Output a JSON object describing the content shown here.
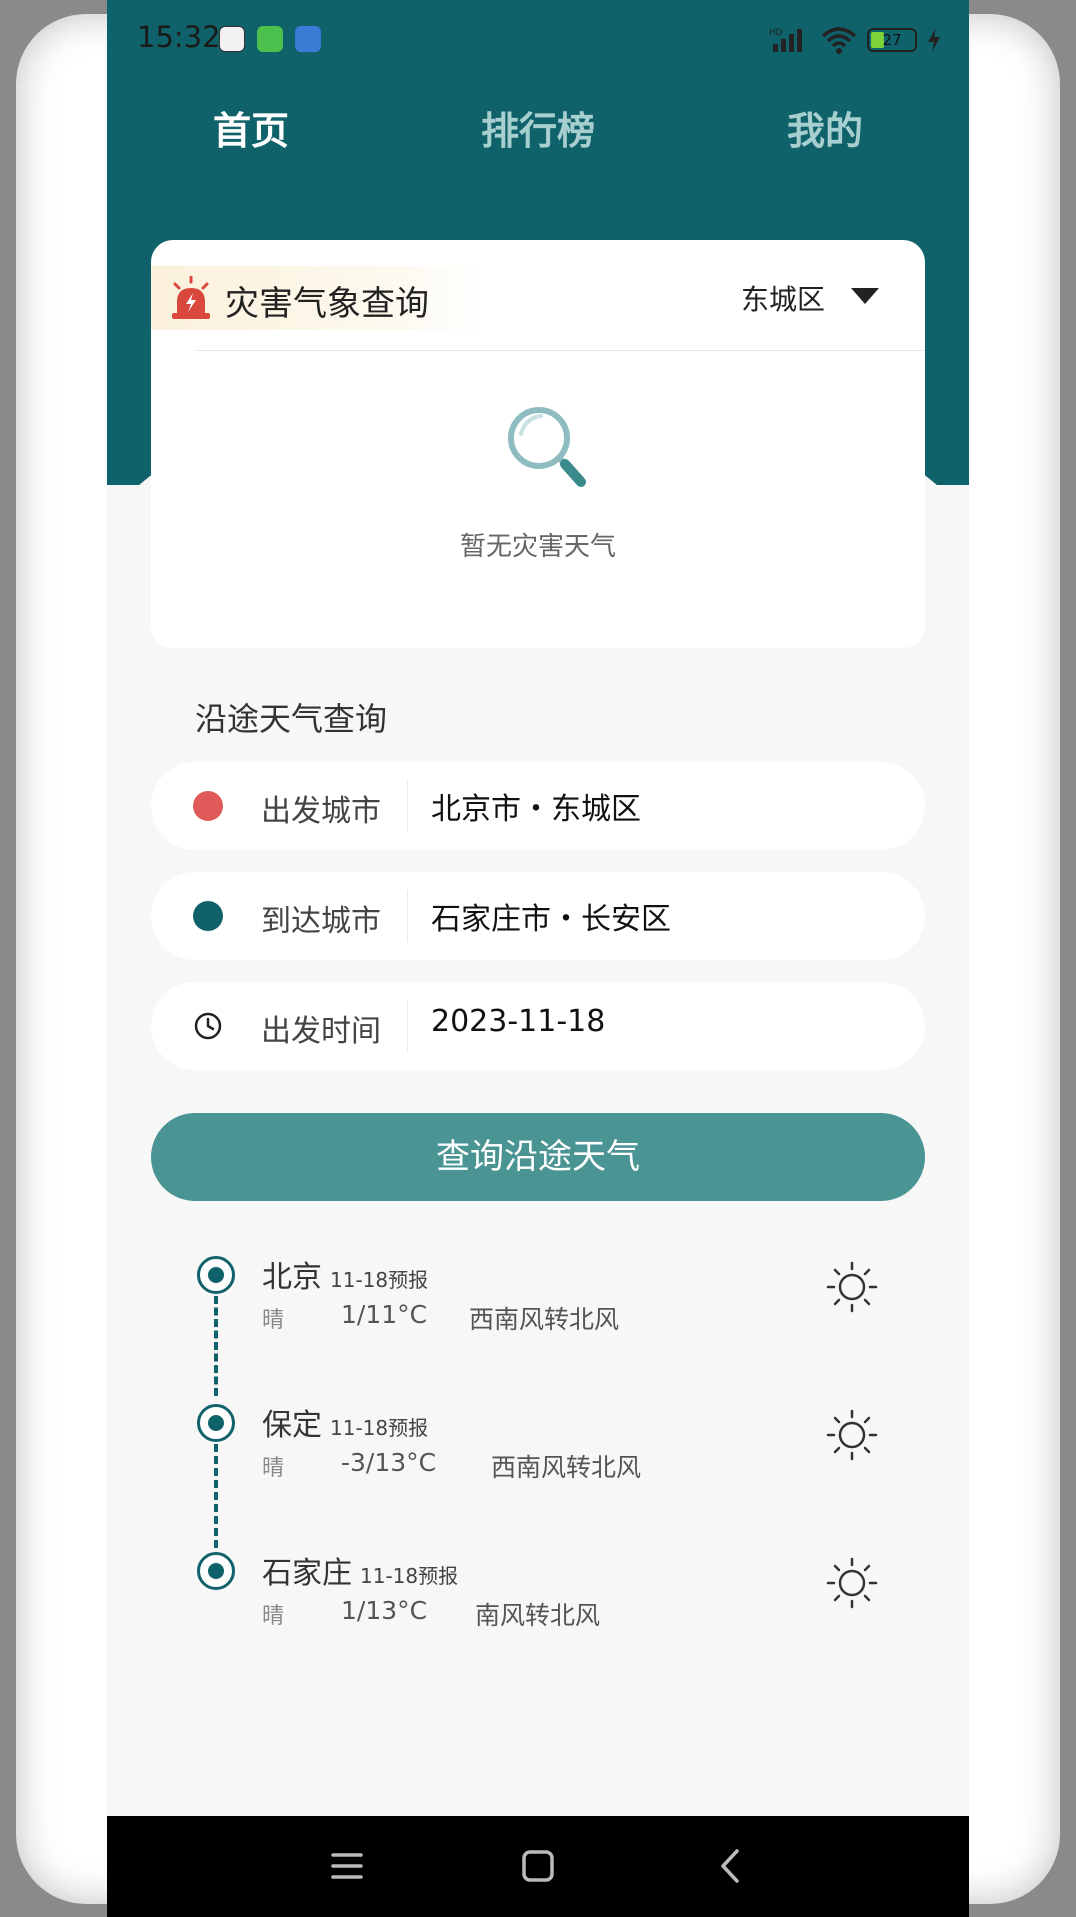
{
  "status_bar": {
    "time": "15:32",
    "battery": "27"
  },
  "tabs": [
    {
      "label": "首页"
    },
    {
      "label": "排行榜"
    },
    {
      "label": "我的"
    }
  ],
  "disaster_card": {
    "title": "灾害气象查询",
    "district": "东城区",
    "empty_text": "暂无灾害天气"
  },
  "route_query": {
    "section_title": "沿途天气查询",
    "departure": {
      "label": "出发城市",
      "value": "北京市・东城区"
    },
    "arrival": {
      "label": "到达城市",
      "value": "石家庄市・长安区"
    },
    "time": {
      "label": "出发时间",
      "value": "2023-11-18"
    },
    "button_label": "查询沿途天气"
  },
  "timeline": [
    {
      "city": "北京",
      "tag": "11-18预报",
      "condition": "晴",
      "temp": "1/11°C",
      "wind": "西南风转北风"
    },
    {
      "city": "保定",
      "tag": "11-18预报",
      "condition": "晴",
      "temp": "-3/13°C",
      "wind": "西南风转北风"
    },
    {
      "city": "石家庄",
      "tag": "11-18预报",
      "condition": "晴",
      "temp": "1/13°C",
      "wind": "南风转北风"
    }
  ],
  "colors": {
    "primary": "#10626a",
    "button": "#4a9494",
    "departure_dot": "#e05a5a",
    "arrival_dot": "#10626a"
  },
  "icons": [
    "alarm-icon",
    "search-icon",
    "clock-icon",
    "sun-icon",
    "menu-icon",
    "home-icon",
    "back-icon"
  ]
}
